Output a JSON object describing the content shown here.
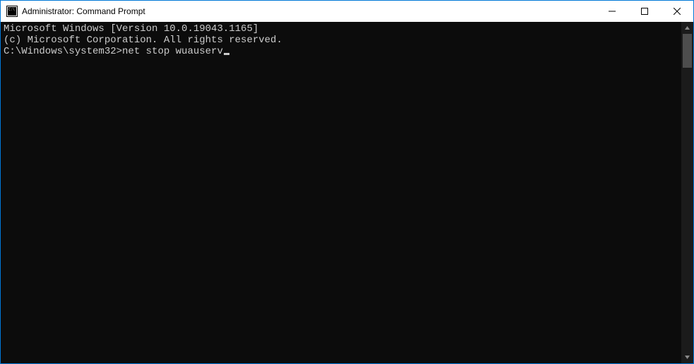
{
  "window": {
    "title": "Administrator: Command Prompt"
  },
  "terminal": {
    "line1": "Microsoft Windows [Version 10.0.19043.1165]",
    "line2": "(c) Microsoft Corporation. All rights reserved.",
    "blank": "",
    "prompt": "C:\\Windows\\system32>",
    "command": "net stop wuauserv"
  }
}
